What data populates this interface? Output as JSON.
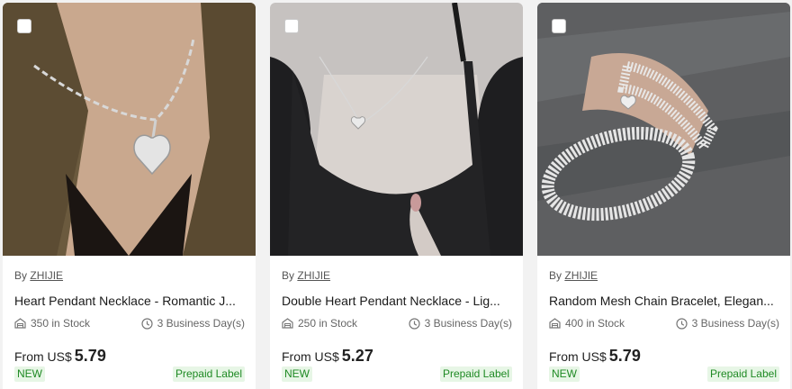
{
  "products": [
    {
      "by_label": "By",
      "seller": "ZHIJIE",
      "title": "Heart Pendant Necklace - Romantic J...",
      "stock": "350 in Stock",
      "shipping": "3 Business Day(s)",
      "price_prefix": "From US$",
      "price": "5.79",
      "badge_new": "NEW",
      "badge_label": "Prepaid Label",
      "image_icon": "heart-pendant-necklace-photo"
    },
    {
      "by_label": "By",
      "seller": "ZHIJIE",
      "title": "Double Heart Pendant Necklace - Lig...",
      "stock": "250 in Stock",
      "shipping": "3 Business Day(s)",
      "price_prefix": "From US$",
      "price": "5.27",
      "badge_new": "NEW",
      "badge_label": "Prepaid Label",
      "image_icon": "double-heart-necklace-photo"
    },
    {
      "by_label": "By",
      "seller": "ZHIJIE",
      "title": "Random Mesh Chain Bracelet, Elegan...",
      "stock": "400 in Stock",
      "shipping": "3 Business Day(s)",
      "price_prefix": "From US$",
      "price": "5.79",
      "badge_new": "NEW",
      "badge_label": "Prepaid Label",
      "image_icon": "mesh-chain-bracelet-photo"
    }
  ],
  "colors": {
    "badge_bg": "#e7f6e6",
    "badge_text": "#1f8a24",
    "page_bg": "#f2f2f2"
  }
}
